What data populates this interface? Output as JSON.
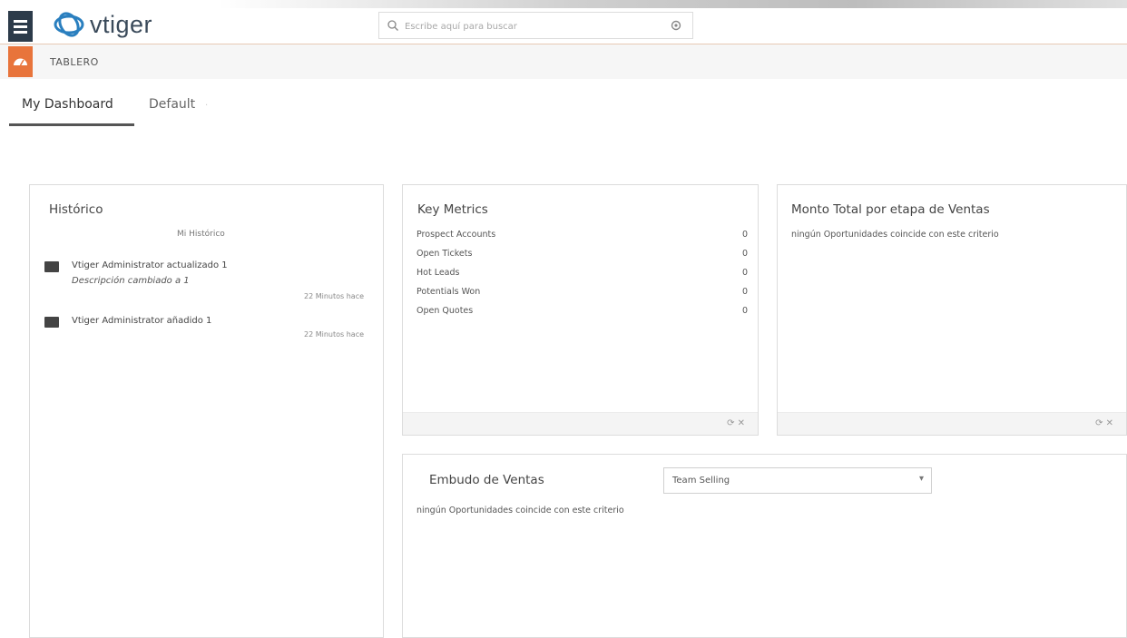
{
  "header": {
    "logo_text": "vtiger",
    "search_placeholder": "Escribe aquí para buscar"
  },
  "module": {
    "title": "TABLERO"
  },
  "tabs": [
    {
      "label": "My Dashboard",
      "active": true
    },
    {
      "label": "Default",
      "active": false
    }
  ],
  "widgets": {
    "historico": {
      "title": "Histórico",
      "subtitle": "Mi Histórico",
      "items": [
        {
          "text": "Vtiger Administrator actualizado 1",
          "desc": "Descripción cambiado a 1",
          "time": "22 Minutos hace"
        },
        {
          "text": "Vtiger Administrator añadido 1",
          "desc": "",
          "time": "22 Minutos hace"
        }
      ]
    },
    "key_metrics": {
      "title": "Key Metrics",
      "rows": [
        {
          "label": "Prospect Accounts",
          "value": "0"
        },
        {
          "label": "Open Tickets",
          "value": "0"
        },
        {
          "label": "Hot Leads",
          "value": "0"
        },
        {
          "label": "Potentials Won",
          "value": "0"
        },
        {
          "label": "Open Quotes",
          "value": "0"
        }
      ],
      "footer_icons": "⟳ ✕"
    },
    "monto_total": {
      "title": "Monto Total por etapa de Ventas",
      "message": "ningún Oportunidades coincide con este criterio",
      "footer_icons": "⟳ ✕"
    },
    "embudo": {
      "title": "Embudo de Ventas",
      "select_value": "Team Selling",
      "message": "ningún Oportunidades coincide con este criterio"
    }
  },
  "colors": {
    "menu_bg": "#2c3b4a",
    "module_icon_bg": "#e8743b",
    "header_border": "#e8c9b4"
  }
}
